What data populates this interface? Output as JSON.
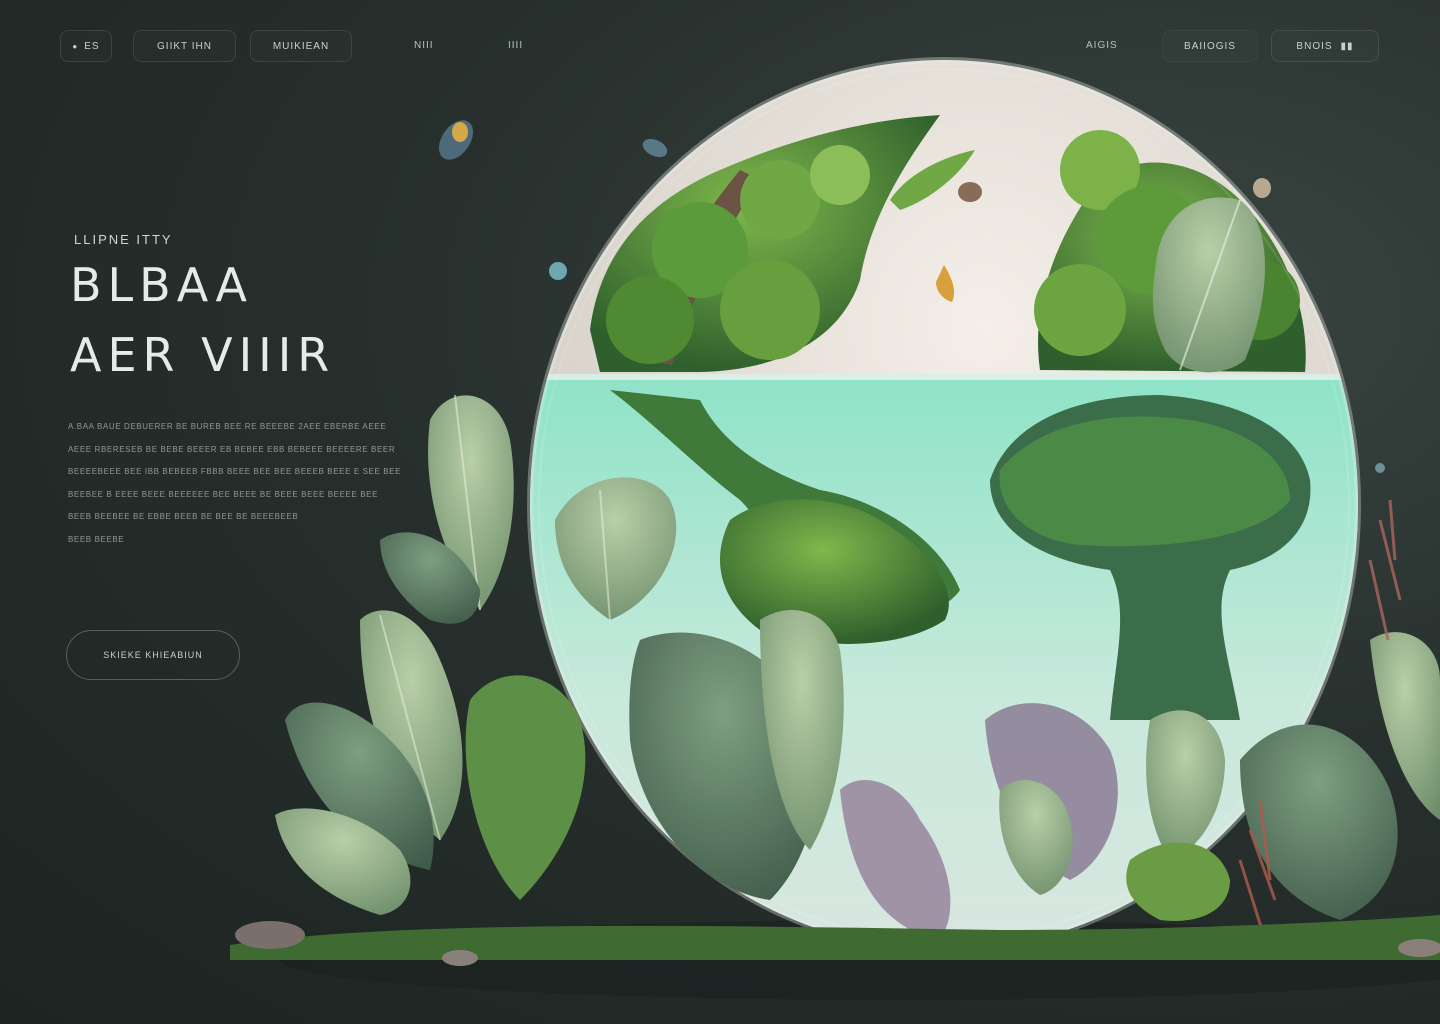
{
  "nav": {
    "lang_label": "ES",
    "btn_start": "GIIKT IHN",
    "btn_museum": "MUIKIEAN",
    "link_a": "NIII",
    "link_b": "IIII",
    "link_about": "AIGIS",
    "btn_brands": "BAIIOGIS",
    "btn_bows": "BNOIS",
    "menu_icon": "menu-icon"
  },
  "hero": {
    "eyebrow": "LLIPNE ITTY",
    "title_line1": "BLBAA",
    "title_line2": "AER VIIIR",
    "paragraph": [
      "A.BAA BAUE DEBUERER BE BUREB BEE RE BEEEBE 2AEE EBERBE AEEE",
      "AEEE RBERESEB BE BEBE BEEER EB BEBEE EBB BEBEEE BEEEERE BEER",
      "BEEEEBEEE BEE IBB BEBEEB FBBB BEEE BEE BEE BEEEB BEEE E SEE BEE",
      "BEEBEE B EEEE BEEE BEEEEEE BEE BEEE BE BEEE BEEE BEEEE BEE",
      "BEEB BEEBEE BE EBBE BEEB BE BEE BE BEEEBEEB",
      "BEEB BEEBE"
    ],
    "cta_label": "SKIEKE KHIEABIUN"
  },
  "colors": {
    "background": "#242c29",
    "accent_green": "#4f8a3c",
    "water": "#7fd3b8"
  }
}
